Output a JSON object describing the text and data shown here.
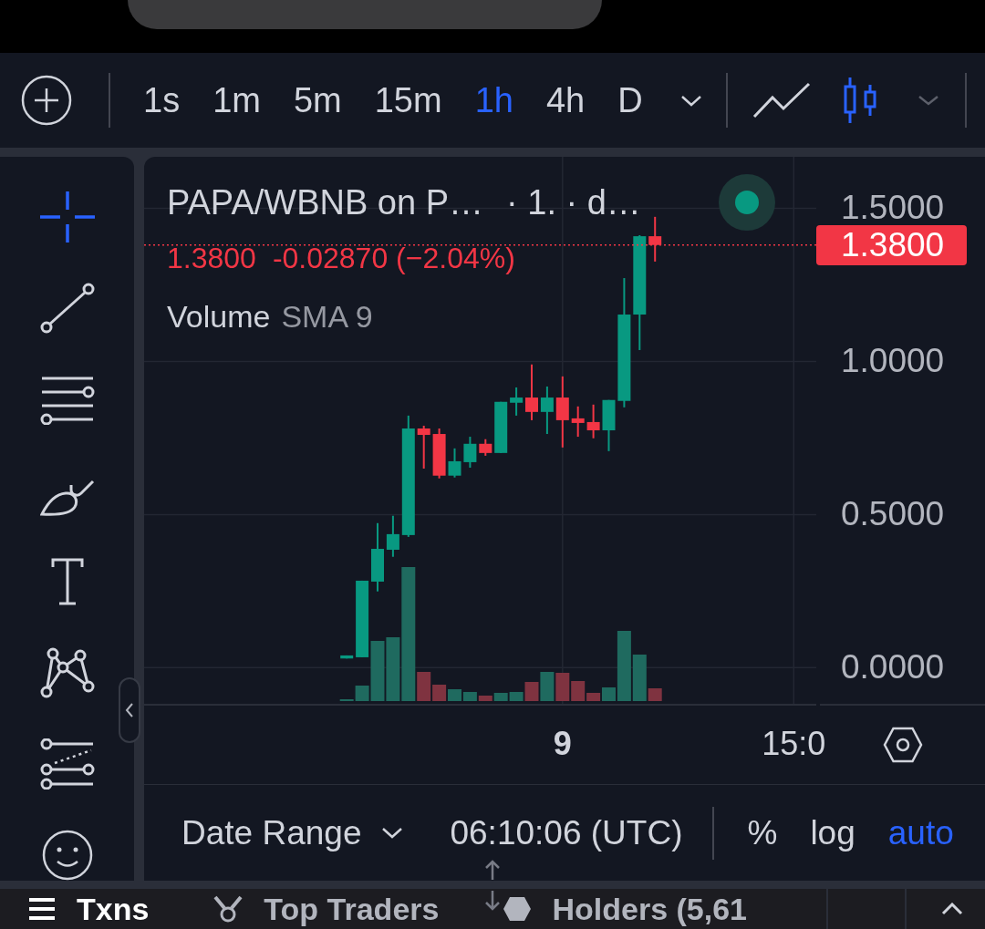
{
  "toolbar": {
    "intervals": [
      {
        "label": "1s",
        "selected": false
      },
      {
        "label": "1m",
        "selected": false
      },
      {
        "label": "5m",
        "selected": false
      },
      {
        "label": "15m",
        "selected": false
      },
      {
        "label": "1h",
        "selected": true
      },
      {
        "label": "4h",
        "selected": false
      },
      {
        "label": "D",
        "selected": false
      }
    ],
    "chart_types": [
      {
        "kind": "line",
        "selected": false
      },
      {
        "kind": "candles",
        "selected": true
      }
    ]
  },
  "drawing_tools": [
    {
      "kind": "crosshair",
      "selected": true
    },
    {
      "kind": "trend-line",
      "selected": false
    },
    {
      "kind": "fib",
      "selected": false
    },
    {
      "kind": "brush",
      "selected": false
    },
    {
      "kind": "text",
      "selected": false
    },
    {
      "kind": "pattern",
      "selected": false
    },
    {
      "kind": "prediction",
      "selected": false
    },
    {
      "kind": "emoji",
      "selected": false
    }
  ],
  "chart": {
    "symbol": "PAPA/WBNB on P…",
    "details": "· 1. · d…",
    "last_price": "1.3800",
    "change": "-0.02870 (−2.04%)",
    "indicator": {
      "name": "Volume",
      "params": "SMA 9"
    },
    "chart_data": {
      "type": "candlestick",
      "categories": [
        null,
        null,
        null,
        null,
        null,
        null,
        null,
        null,
        null,
        null,
        null,
        null,
        null,
        null,
        "9",
        null,
        null,
        null,
        null,
        null,
        null,
        null,
        null,
        null,
        null,
        null,
        null,
        null,
        null,
        "15:0"
      ],
      "ohlc": [
        [
          0.03,
          0.04,
          0.03,
          0.04
        ],
        [
          0.034,
          0.284,
          0.034,
          0.284
        ],
        [
          0.281,
          0.472,
          0.249,
          0.388
        ],
        [
          0.385,
          0.496,
          0.362,
          0.436
        ],
        [
          0.433,
          0.823,
          0.427,
          0.781
        ],
        [
          0.781,
          0.79,
          0.65,
          0.76
        ],
        [
          0.763,
          0.781,
          0.618,
          0.627
        ],
        [
          0.627,
          0.716,
          0.621,
          0.674
        ],
        [
          0.671,
          0.754,
          0.653,
          0.731
        ],
        [
          0.731,
          0.746,
          0.692,
          0.701
        ],
        [
          0.701,
          0.868,
          0.701,
          0.868
        ],
        [
          0.865,
          0.915,
          0.823,
          0.882
        ],
        [
          0.882,
          0.99,
          0.808,
          0.835
        ],
        [
          0.835,
          0.918,
          0.763,
          0.882
        ],
        [
          0.882,
          0.951,
          0.719,
          0.808
        ],
        [
          0.814,
          0.853,
          0.754,
          0.799
        ],
        [
          0.802,
          0.859,
          0.749,
          0.775
        ],
        [
          0.775,
          0.874,
          0.707,
          0.874
        ],
        [
          0.871,
          1.272,
          0.85,
          1.153
        ],
        [
          1.153,
          1.412,
          1.037,
          1.4087
        ],
        [
          1.4087,
          1.472,
          1.326,
          1.38
        ],
        null,
        null,
        null,
        null,
        null,
        null,
        null,
        null,
        null
      ],
      "ylim": [
        -0.118,
        1.668
      ],
      "yticks": [
        {
          "value": 1.5,
          "label": "1.5000"
        },
        {
          "value": 1,
          "label": "1.0000"
        },
        {
          "value": 0.5,
          "label": "0.5000"
        },
        {
          "value": 0,
          "label": "0.0000"
        }
      ],
      "grid": true,
      "ref_lines": [
        {
          "axis": "y",
          "value": 1.38,
          "label": "1.3800",
          "color": "#f23645"
        }
      ]
    }
  },
  "bottom_bar": {
    "date_range": "Date Range",
    "clock": "06:10:06 (UTC)",
    "scale_options": [
      {
        "label": "%",
        "selected": false
      },
      {
        "label": "log",
        "selected": false
      },
      {
        "label": "auto",
        "selected": true
      }
    ]
  },
  "tabs": [
    {
      "label": "Txns",
      "selected": true
    },
    {
      "label": "Top Traders",
      "selected": false
    },
    {
      "label": "Holders (5,61",
      "selected": false
    }
  ]
}
